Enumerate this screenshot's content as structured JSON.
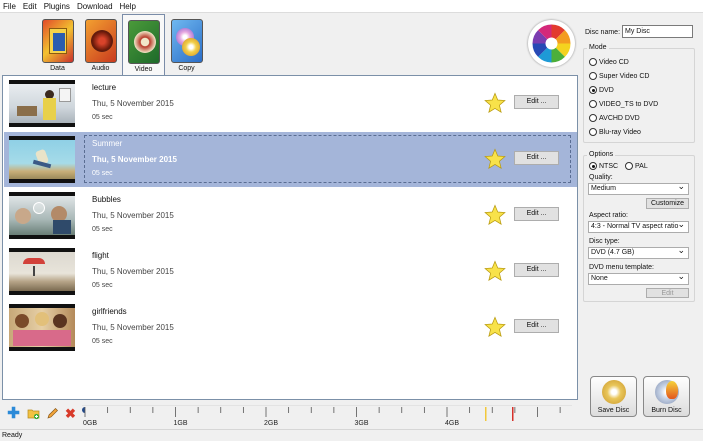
{
  "menu": [
    "File",
    "Edit",
    "Plugins",
    "Download",
    "Help"
  ],
  "tabs": [
    {
      "label": "Data",
      "icon": "data-tab-icon",
      "active": false
    },
    {
      "label": "Audio",
      "icon": "audio-tab-icon",
      "active": false
    },
    {
      "label": "Video",
      "icon": "video-tab-icon",
      "active": true
    },
    {
      "label": "Copy",
      "icon": "copy-tab-icon",
      "active": false
    }
  ],
  "videos": [
    {
      "title": "lecture",
      "date": "Thu, 5 November 2015",
      "duration": "05 sec",
      "edit": "Edit ...",
      "selected": false
    },
    {
      "title": "Summer",
      "date": "Thu, 5 November 2015",
      "duration": "05 sec",
      "edit": "Edit ...",
      "selected": true
    },
    {
      "title": "Bubbles",
      "date": "Thu, 5 November 2015",
      "duration": "05 sec",
      "edit": "Edit ...",
      "selected": false
    },
    {
      "title": "flight",
      "date": "Thu, 5 November 2015",
      "duration": "05 sec",
      "edit": "Edit ...",
      "selected": false
    },
    {
      "title": "girlfriends",
      "date": "Thu, 5 November 2015",
      "duration": "05 sec",
      "edit": "Edit ...",
      "selected": false
    }
  ],
  "disc": {
    "name_label": "Disc name:",
    "name_value": "My Disc"
  },
  "mode": {
    "title": "Mode",
    "options": [
      "Video CD",
      "Super Video CD",
      "DVD",
      "VIDEO_TS to DVD",
      "AVCHD DVD",
      "Blu-ray Video"
    ],
    "selected": "DVD"
  },
  "options": {
    "title": "Options",
    "ntsc": "NTSC",
    "pal": "PAL",
    "standard": "NTSC",
    "quality_label": "Quality:",
    "quality_value": "Medium",
    "customize": "Customize",
    "aspect_label": "Aspect ratio:",
    "aspect_value": "4:3 - Normal TV aspect ratio",
    "disctype_label": "Disc type:",
    "disctype_value": "DVD (4.7 GB)",
    "menu_label": "DVD menu template:",
    "menu_value": "None",
    "menu_edit": "Edit"
  },
  "actions": {
    "save": "Save Disc",
    "burn": "Burn Disc"
  },
  "ruler": {
    "labels": [
      "0GB",
      "1GB",
      "2GB",
      "3GB",
      "4GB"
    ],
    "used_gb": 0
  },
  "status": "Ready"
}
